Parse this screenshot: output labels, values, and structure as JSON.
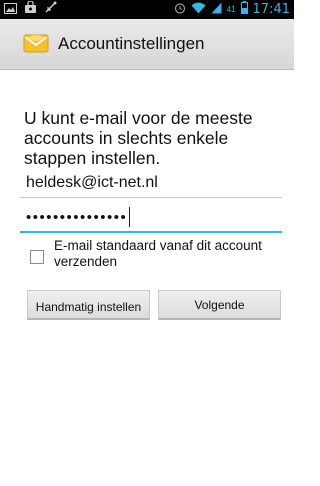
{
  "statusbar": {
    "icons": [
      "gallery-icon",
      "bag-icon",
      "usb-icon",
      "alarm-icon",
      "wifi-icon",
      "signal-icon",
      "battery-icon"
    ],
    "battery_level": "41",
    "time": "17:41",
    "accent_color": "#39b4e6"
  },
  "titlebar": {
    "icon": "email-app-icon",
    "title": "Accountinstellingen"
  },
  "intro": "U kunt e-mail voor de meeste accounts in slechts enkele stappen instellen.",
  "form": {
    "email_value": "heldesk@ict-net.nl",
    "password_value": "•••••••••••••••",
    "default_account_label": "E-mail standaard vanaf dit account verzenden",
    "default_account_checked": false
  },
  "buttons": {
    "manual_label": "Handmatig instellen",
    "next_label": "Volgende"
  }
}
